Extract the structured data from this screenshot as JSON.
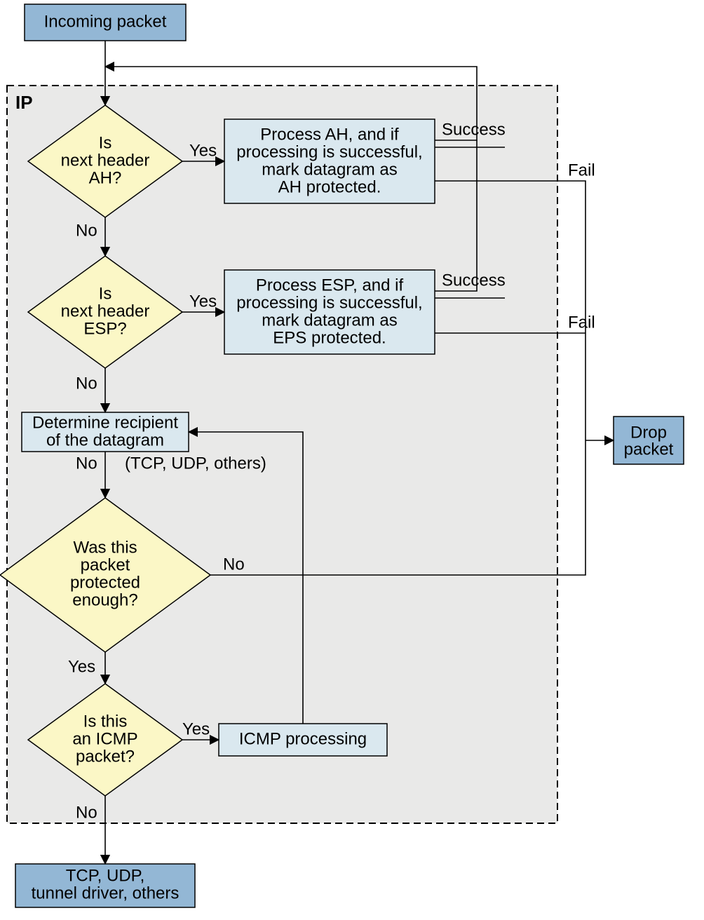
{
  "chart_data": {
    "type": "flowchart",
    "nodes": [
      {
        "id": "incoming",
        "kind": "terminal",
        "label_lines": [
          "Incoming packet"
        ]
      },
      {
        "id": "ip",
        "kind": "container",
        "label_lines": [
          "IP"
        ]
      },
      {
        "id": "d_ah",
        "kind": "decision",
        "label_lines": [
          "Is",
          "next header",
          "AH?"
        ]
      },
      {
        "id": "p_ah",
        "kind": "process",
        "label_lines": [
          "Process AH, and if",
          "processing is successful,",
          "mark datagram as",
          "AH protected."
        ]
      },
      {
        "id": "d_esp",
        "kind": "decision",
        "label_lines": [
          "Is",
          "next header",
          "ESP?"
        ]
      },
      {
        "id": "p_esp",
        "kind": "process",
        "label_lines": [
          "Process ESP, and if",
          "processing is successful,",
          "mark datagram as",
          "EPS protected."
        ]
      },
      {
        "id": "recipient",
        "kind": "process",
        "label_lines": [
          "Determine recipient",
          "of the datagram"
        ]
      },
      {
        "id": "d_protect",
        "kind": "decision",
        "label_lines": [
          "Was this",
          "packet",
          "protected",
          "enough?"
        ]
      },
      {
        "id": "d_icmp",
        "kind": "decision",
        "label_lines": [
          "Is this",
          "an ICMP",
          "packet?"
        ]
      },
      {
        "id": "p_icmp",
        "kind": "process",
        "label_lines": [
          "ICMP processing"
        ]
      },
      {
        "id": "drop",
        "kind": "terminal",
        "label_lines": [
          "Drop",
          "packet"
        ]
      },
      {
        "id": "out",
        "kind": "terminal",
        "label_lines": [
          "TCP, UDP,",
          "tunnel driver, others"
        ]
      }
    ],
    "edges": [
      {
        "from": "incoming",
        "to": "d_ah",
        "label": ""
      },
      {
        "from": "d_ah",
        "to": "p_ah",
        "label": "Yes"
      },
      {
        "from": "d_ah",
        "to": "d_esp",
        "label": "No"
      },
      {
        "from": "p_ah",
        "to": "incoming",
        "label": "Success"
      },
      {
        "from": "p_ah",
        "to": "drop",
        "label": "Fail"
      },
      {
        "from": "d_esp",
        "to": "p_esp",
        "label": "Yes"
      },
      {
        "from": "d_esp",
        "to": "recipient",
        "label": "No"
      },
      {
        "from": "p_esp",
        "to": "incoming",
        "label": "Success"
      },
      {
        "from": "p_esp",
        "to": "drop",
        "label": "Fail"
      },
      {
        "from": "recipient",
        "to": "d_protect",
        "label": "No  (TCP, UDP, others)"
      },
      {
        "from": "d_protect",
        "to": "d_icmp",
        "label": "Yes"
      },
      {
        "from": "d_protect",
        "to": "drop",
        "label": "No"
      },
      {
        "from": "d_icmp",
        "to": "p_icmp",
        "label": "Yes"
      },
      {
        "from": "d_icmp",
        "to": "out",
        "label": "No"
      },
      {
        "from": "p_icmp",
        "to": "recipient",
        "label": ""
      }
    ],
    "labels": {
      "yes": "Yes",
      "no": "No",
      "success": "Success",
      "fail": "Fail",
      "recipient_note": "(TCP, UDP, others)"
    }
  }
}
